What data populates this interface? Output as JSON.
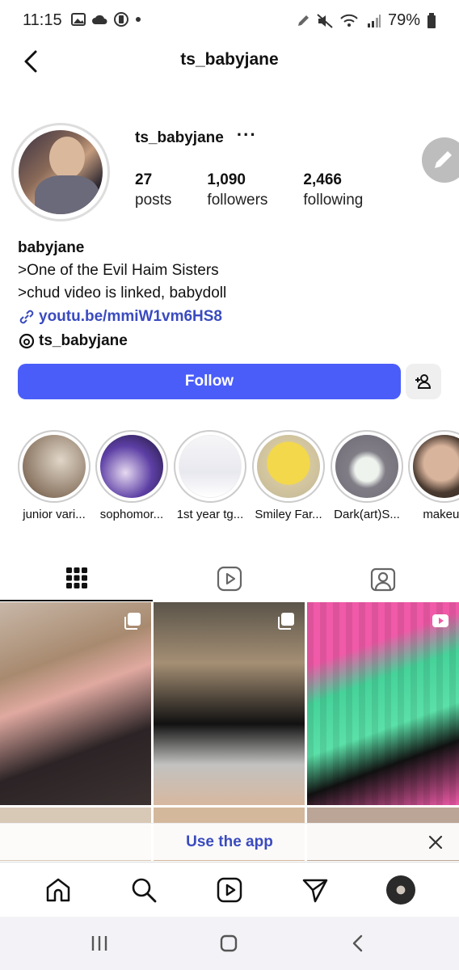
{
  "status_bar": {
    "time": "11:15",
    "battery": "79%",
    "left_icons": [
      "gallery-icon",
      "cloud-icon",
      "app-icon",
      "dot-icon"
    ],
    "right_icons": [
      "pen-icon",
      "mute-icon",
      "wifi-icon",
      "signal-icon",
      "battery-icon"
    ]
  },
  "header": {
    "title": "ts_babyjane"
  },
  "profile": {
    "username": "ts_babyjane",
    "more_label": "···",
    "stats": [
      {
        "num": "27",
        "label": "posts"
      },
      {
        "num": "1,090",
        "label": "followers"
      },
      {
        "num": "2,466",
        "label": "following"
      }
    ]
  },
  "bio": {
    "name": "babyjane",
    "line1": ">One of the Evil Haim Sisters",
    "line2": ">chud video is linked, babydoll",
    "link": "youtu.be/mmiW1vm6HS8",
    "threads": "ts_babyjane"
  },
  "actions": {
    "follow_label": "Follow"
  },
  "highlights": [
    {
      "label": "junior vari..."
    },
    {
      "label": "sophomor..."
    },
    {
      "label": "1st year tg..."
    },
    {
      "label": "Smiley Far..."
    },
    {
      "label": "Dark(art)S..."
    },
    {
      "label": "makeup"
    }
  ],
  "banner": {
    "text": "Use the app"
  },
  "colors": {
    "accent": "#4a5df9",
    "link": "#3a4bbf"
  }
}
